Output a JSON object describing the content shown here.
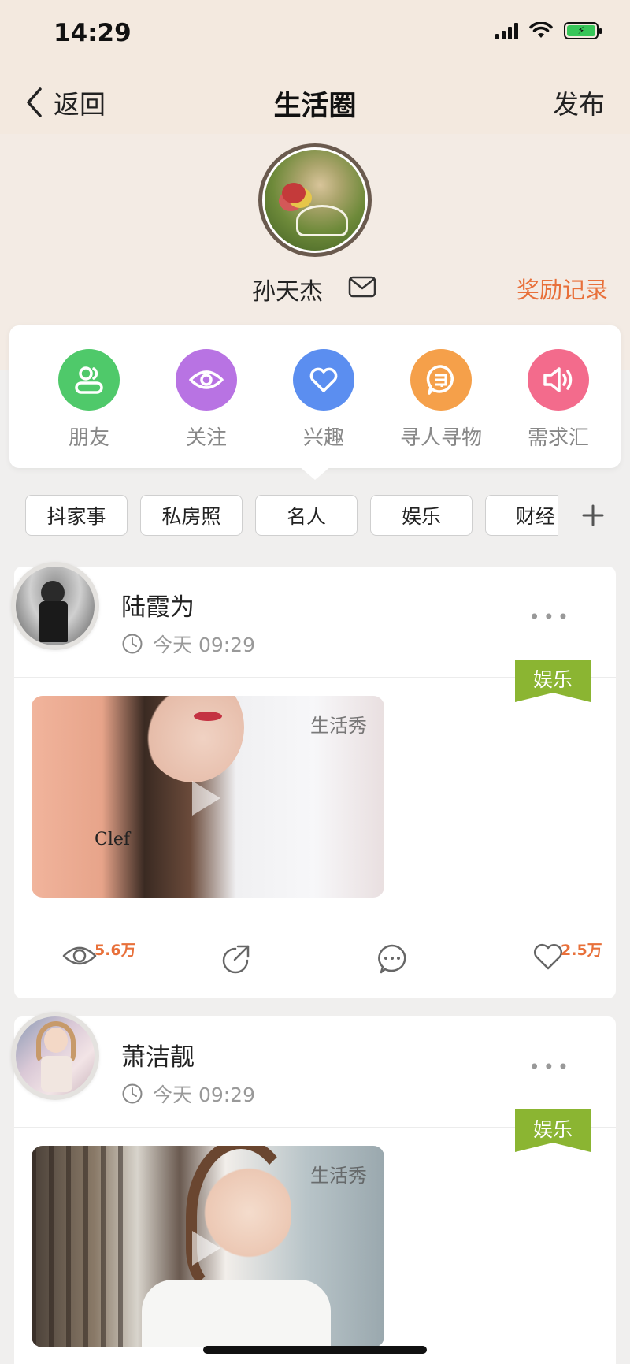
{
  "status_bar": {
    "time": "14:29"
  },
  "nav": {
    "back_label": "返回",
    "title": "生活圈",
    "publish_label": "发布"
  },
  "profile": {
    "name": "孙天杰",
    "reward_label": "奖励记录"
  },
  "categories": [
    {
      "label": "朋友",
      "icon": "friends-icon",
      "color": "#4fc96a"
    },
    {
      "label": "关注",
      "icon": "eye-icon",
      "color": "#b873e3"
    },
    {
      "label": "兴趣",
      "icon": "heart-icon",
      "color": "#5b8ef0"
    },
    {
      "label": "寻人寻物",
      "icon": "search-chat-icon",
      "color": "#f5a04a"
    },
    {
      "label": "需求汇",
      "icon": "speaker-icon",
      "color": "#f36b8c"
    }
  ],
  "tags": [
    "抖家事",
    "私房照",
    "名人",
    "娱乐",
    "财经"
  ],
  "selected_tag": "名人",
  "posts": [
    {
      "author": "陆霞为",
      "time": "今天 09:29",
      "category": "娱乐",
      "watermark": "生活秀",
      "views": "5.6万",
      "likes": "2.5万"
    },
    {
      "author": "萧洁靓",
      "time": "今天 09:29",
      "category": "娱乐",
      "watermark": "生活秀"
    }
  ],
  "colors": {
    "accent": "#e8703a",
    "tag_green": "#8bb532"
  }
}
